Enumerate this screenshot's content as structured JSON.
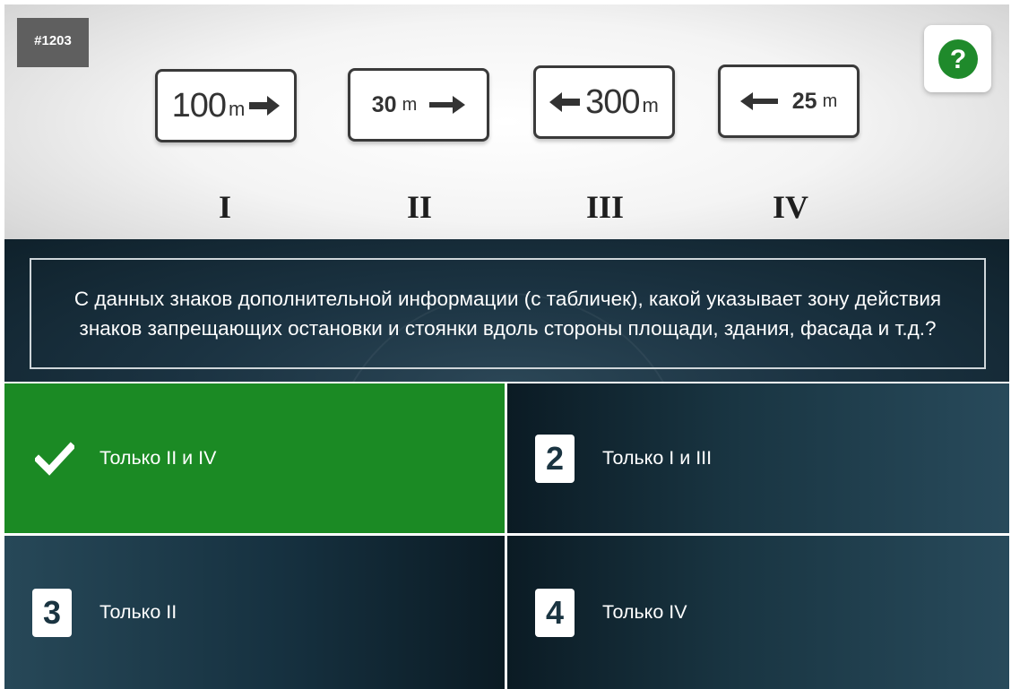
{
  "question_id": "#1203",
  "help_icon": "question-circle-icon",
  "signs": [
    {
      "number": "100",
      "unit": "m",
      "arrow": "right",
      "roman": "I"
    },
    {
      "number": "30",
      "unit": "m",
      "arrow": "right",
      "roman": "II"
    },
    {
      "number": "300",
      "unit": "m",
      "arrow": "left",
      "roman": "III"
    },
    {
      "number": "25",
      "unit": "m",
      "arrow": "left",
      "roman": "IV"
    }
  ],
  "question": {
    "text": "С данных знаков дополнительной информации (с табличек), какой указывает зону действия знаков запрещающих остановки и стоянки вдоль стороны площади, здания, фасада и т.д.?"
  },
  "answers": [
    {
      "number": "1",
      "text": "Только II и IV",
      "state": "correct",
      "icon": "checkmark-icon"
    },
    {
      "number": "2",
      "text": "Только I и III",
      "state": "default"
    },
    {
      "number": "3",
      "text": "Только II",
      "state": "default"
    },
    {
      "number": "4",
      "text": "Только IV",
      "state": "default"
    }
  ],
  "colors": {
    "correct": "#1b8a24",
    "dark_teal": "#193542",
    "help_icon": "#1f8a2b",
    "id_badge": "#5f5f5f"
  }
}
